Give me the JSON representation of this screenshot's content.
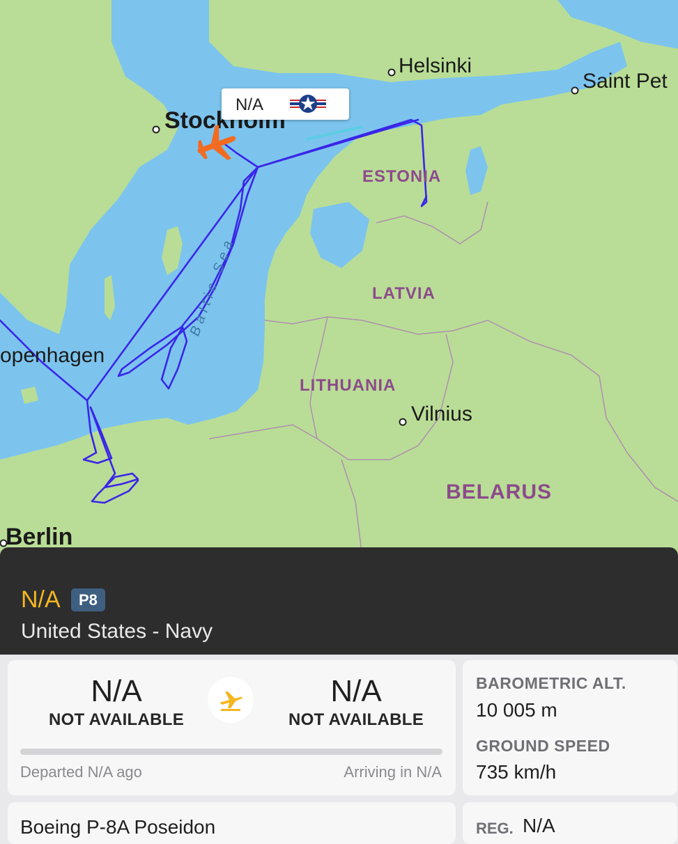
{
  "map": {
    "cities": {
      "helsinki": "Helsinki",
      "saint_petersburg": "Saint Pet",
      "stockholm": "Stockholm",
      "copenhagen": "openhagen",
      "vilnius": "Vilnius",
      "berlin": "Berlin"
    },
    "countries": {
      "estonia": "ESTONIA",
      "latvia": "LATVIA",
      "lithuania": "LITHUANIA",
      "belarus": "BELARUS"
    },
    "sea_label": "Baltic Sea",
    "callout": {
      "label": "N/A",
      "flag_icon": "us-military-roundel-icon"
    },
    "aircraft_icon": "aircraft-icon",
    "colors": {
      "water": "#7cc4ee",
      "land": "#b9dd96",
      "track": "#3a25e8",
      "aircraft": "#f26b21"
    }
  },
  "flight": {
    "callsign": "N/A",
    "type_code": "P8",
    "operator": "United States - Navy"
  },
  "route": {
    "origin": {
      "code": "N/A",
      "name": "NOT AVAILABLE"
    },
    "destination": {
      "code": "N/A",
      "name": "NOT AVAILABLE"
    },
    "plane_icon": "plane-icon",
    "progress": 0,
    "departed": "Departed N/A ago",
    "arriving": "Arriving in N/A"
  },
  "stats": {
    "altitude_label": "BAROMETRIC ALT.",
    "altitude_value": "10 005 m",
    "speed_label": "GROUND SPEED",
    "speed_value": "735 km/h"
  },
  "aircraft": {
    "model": "Boeing P-8A Poseidon",
    "reg_label": "REG.",
    "reg_value": "N/A"
  },
  "accent_colors": {
    "callsign": "#f5b720",
    "badge": "#3e5f80",
    "header_bg": "#2d2d2d"
  }
}
